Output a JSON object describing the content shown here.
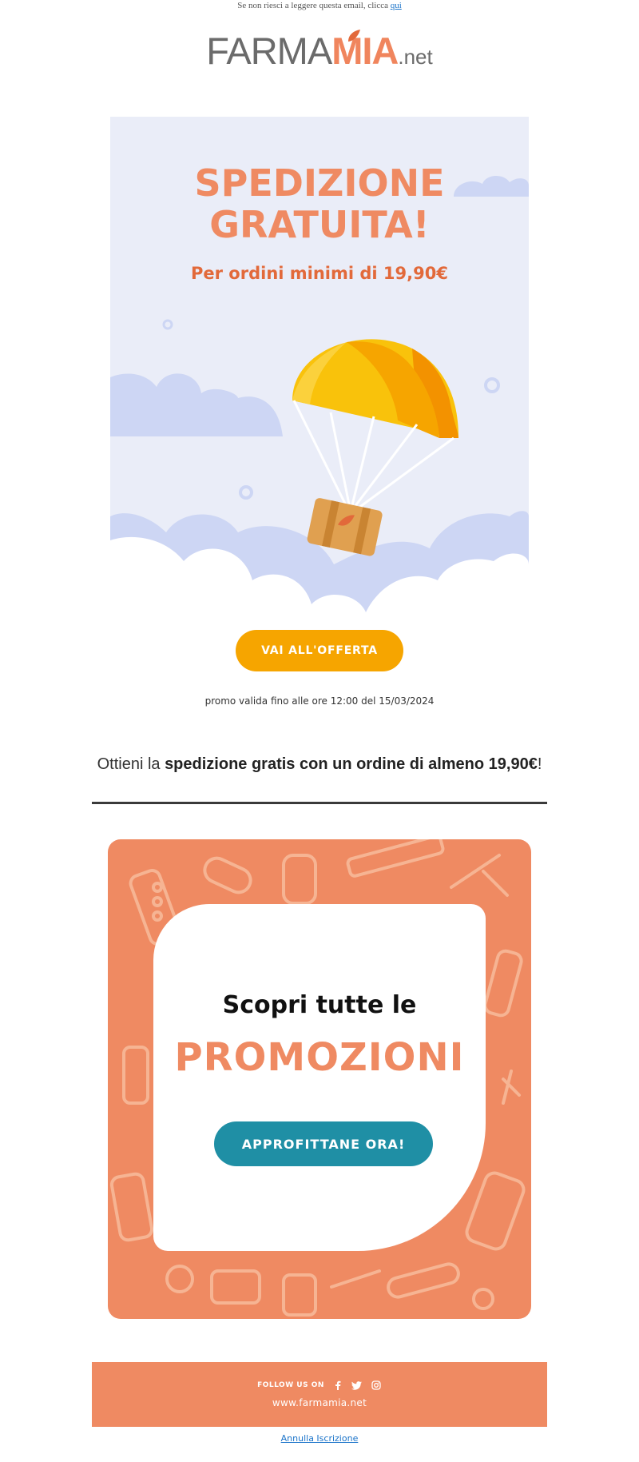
{
  "preheader": {
    "text": "Se non riesci a leggere questa email, clicca ",
    "link_label": "qui"
  },
  "logo": {
    "part1": "FARMA",
    "part2": "MIA",
    "part3": ".net"
  },
  "hero": {
    "title_line1": "SPEDIZIONE",
    "title_line2": "GRATUITA!",
    "subtitle": "Per ordini minimi di 19,90€",
    "illustration_icons": [
      "parachute-icon",
      "package-box-icon",
      "cloud-icon"
    ]
  },
  "offer_button": {
    "label": "VAI ALL'OFFERTA"
  },
  "promo_validity": "promo valida fino alle ore 12:00 del 15/03/2024",
  "intro": {
    "prefix": "Ottieni la ",
    "bold": "spedizione gratis con un ordine di almeno 19,90€",
    "suffix": "!"
  },
  "promotions": {
    "line1": "Scopri tutte le",
    "line2": "PROMOZIONI",
    "button_label": "APPROFITTANE ORA!"
  },
  "footer": {
    "follow_label": "FOLLOW US ON",
    "social_icons": [
      "facebook-icon",
      "twitter-icon",
      "instagram-icon"
    ],
    "website": "www.farmamia.net"
  },
  "unsubscribe_label": "Annulla Iscrizione",
  "colors": {
    "brand_orange": "#ef8a62",
    "offer_button": "#f6a500",
    "promo_button": "#1f8fa5",
    "hero_background": "#eaedf8"
  }
}
